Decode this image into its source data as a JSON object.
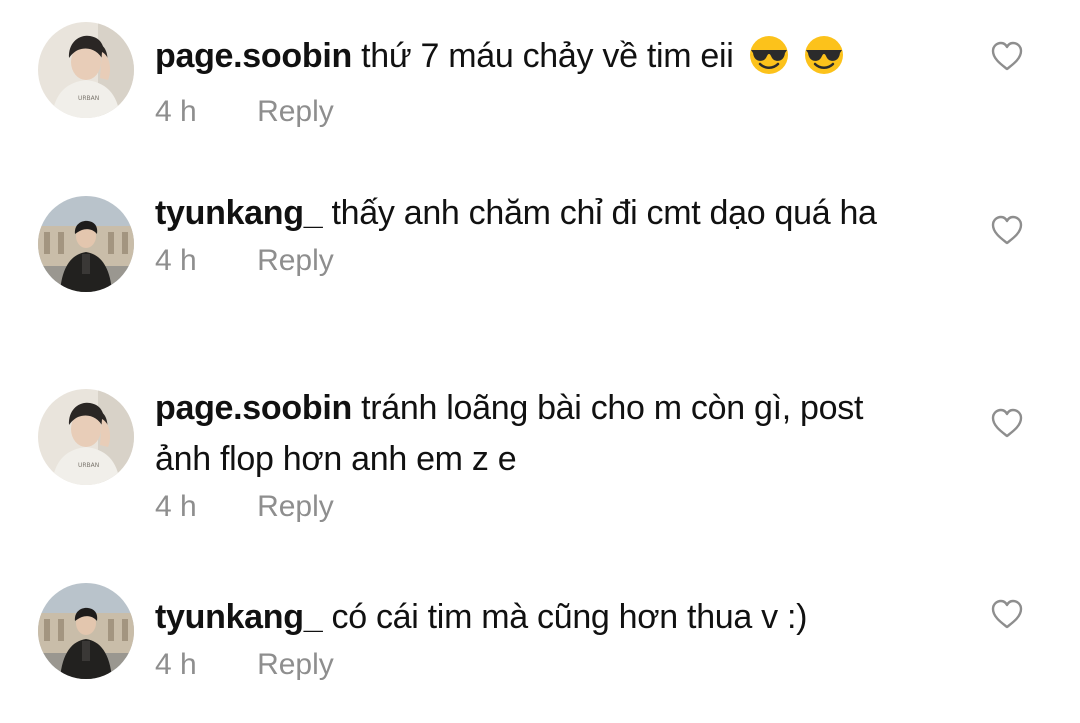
{
  "comments": [
    {
      "username": "page.soobin",
      "text": "thứ 7 máu chảy về tim eii",
      "emojis": [
        "sunglasses-emoji",
        "sunglasses-emoji"
      ],
      "time": "4 h",
      "reply_label": "Reply",
      "avatar": "avatar-page-soobin"
    },
    {
      "username": "tyunkang_",
      "text": "thấy anh chăm chỉ đi cmt dạo quá ha",
      "time": "4 h",
      "reply_label": "Reply",
      "avatar": "avatar-tyunkang"
    },
    {
      "username": "page.soobin",
      "text": "tránh loãng bài cho m còn gì, post ảnh flop hơn anh em z e",
      "time": "4 h",
      "reply_label": "Reply",
      "avatar": "avatar-page-soobin"
    },
    {
      "username": "tyunkang_",
      "text": "có cái tim mà cũng hơn thua v :)",
      "time": "4 h",
      "reply_label": "Reply",
      "avatar": "avatar-tyunkang"
    }
  ],
  "icons": {
    "like": "heart-outline-icon"
  },
  "colors": {
    "text": "#111111",
    "meta": "#8e8e8e",
    "background": "#ffffff"
  }
}
